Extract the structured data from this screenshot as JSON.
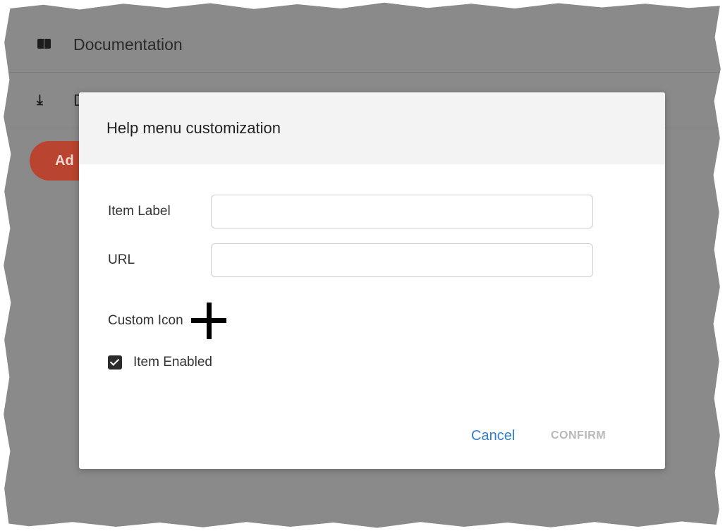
{
  "background": {
    "items": [
      {
        "label": "Documentation",
        "icon": "book-icon"
      },
      {
        "label": "D",
        "icon": "download-icon"
      }
    ],
    "add_button_label": "Ad"
  },
  "modal": {
    "title": "Help menu customization",
    "fields": {
      "item_label": {
        "label": "Item Label",
        "value": "",
        "placeholder": ""
      },
      "url": {
        "label": "URL",
        "value": "",
        "placeholder": ""
      }
    },
    "custom_icon_label": "Custom Icon",
    "custom_icon": "plus-icon",
    "item_enabled_label": "Item Enabled",
    "item_enabled_checked": true,
    "cancel_label": "Cancel",
    "confirm_label": "CONFIRM"
  },
  "colors": {
    "overlay": "#8a8a8a",
    "accent_link": "#2f7fd0",
    "disabled_text": "#b8b8b8",
    "add_button": "#b9442f"
  }
}
